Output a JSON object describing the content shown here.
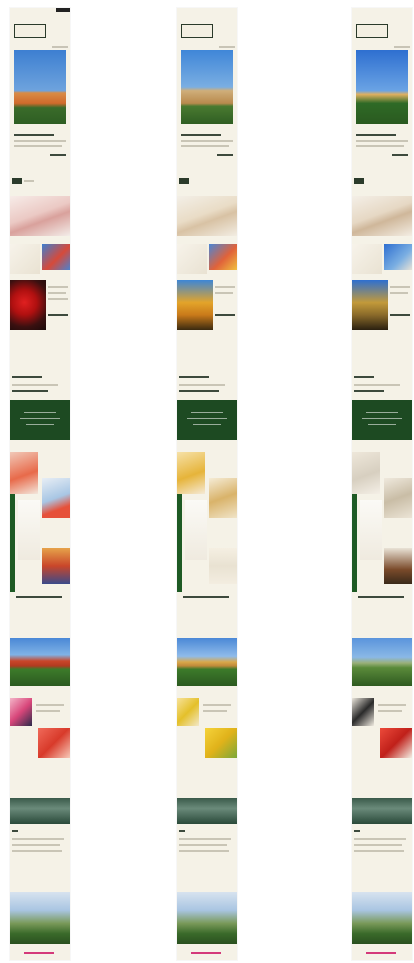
{
  "strips": [
    {
      "id": "s1"
    },
    {
      "id": "s2"
    },
    {
      "id": "s3"
    }
  ],
  "colors": {
    "background": "#f5f2e7",
    "brand_green": "#1d4a22",
    "accent_pink": "#d43a7a"
  }
}
